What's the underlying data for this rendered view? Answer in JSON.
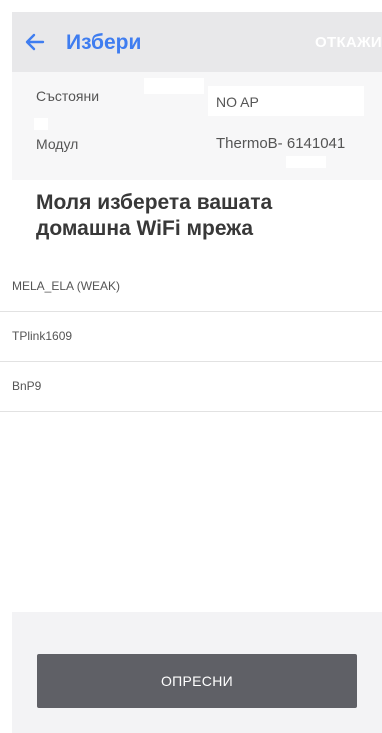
{
  "header": {
    "title": "Избери",
    "cancel_label": "ОТКАЖИ",
    "back_icon": "arrow-left-icon",
    "accent_color": "#3f7df0"
  },
  "info": {
    "status_label": "Състояни",
    "status_value": "NO AP",
    "module_label": "Модул",
    "module_value": "ThermoB- 6141041"
  },
  "heading": {
    "line1": "Моля изберета вашата",
    "line2": "домашна WiFi мрежа"
  },
  "networks": [
    {
      "ssid": "MELA_ELA  (WEAK)"
    },
    {
      "ssid": "TPlink1609"
    },
    {
      "ssid": "BnP9"
    }
  ],
  "footer": {
    "refresh_label": "ОПРЕСНИ"
  }
}
